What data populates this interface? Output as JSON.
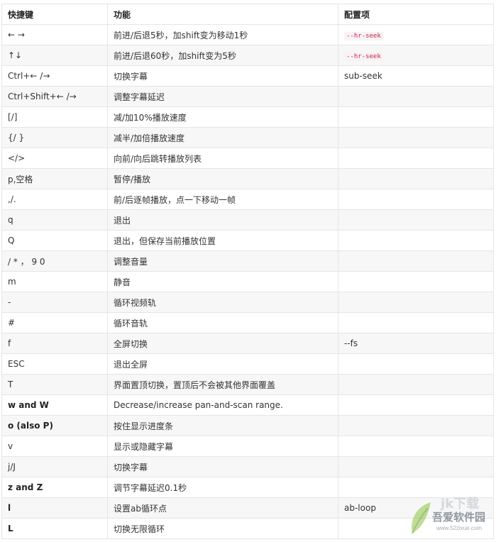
{
  "headers": [
    "快捷键",
    "功能",
    "配置项"
  ],
  "rows": [
    {
      "key": "← →",
      "func": "前进/后退5秒，加shift变为移动1秒",
      "opt": "--hr-seek",
      "opt_code": true
    },
    {
      "key": "↑↓",
      "func": "前进/后退60秒，加shift变为5秒",
      "opt": "--hr-seek",
      "opt_code": true
    },
    {
      "key": "Ctrl+← /→",
      "func": "切换字幕",
      "opt": "sub-seek"
    },
    {
      "key": "Ctrl+Shift+← /→",
      "func": "调整字幕延迟",
      "opt": ""
    },
    {
      "key": "[/]",
      "func": "减/加10%播放速度",
      "opt": ""
    },
    {
      "key": "{/ }",
      "func": "减半/加倍播放速度",
      "opt": ""
    },
    {
      "key": "</>",
      "func": "向前/向后跳转播放列表",
      "opt": ""
    },
    {
      "key": "p,空格",
      "func": "暂停/播放",
      "opt": ""
    },
    {
      "key": ",/.",
      "func": "前/后逐帧播放，点一下移动一帧",
      "opt": ""
    },
    {
      "key": "q",
      "func": "退出",
      "opt": ""
    },
    {
      "key": "Q",
      "func": "退出，但保存当前播放位置",
      "opt": ""
    },
    {
      "key": "/ * ，  9 0",
      "func": "调整音量",
      "opt": ""
    },
    {
      "key": "m",
      "func": "静音",
      "opt": ""
    },
    {
      "key": "-",
      "func": "循环视频轨",
      "opt": ""
    },
    {
      "key": "#",
      "func": "循环音轨",
      "opt": ""
    },
    {
      "key": "f",
      "func": "全屏切换",
      "opt": "--fs"
    },
    {
      "key": "ESC",
      "func": "退出全屏",
      "opt": ""
    },
    {
      "key": "T",
      "func": "界面置顶切换，置顶后不会被其他界面覆盖",
      "opt": ""
    },
    {
      "key": "w and W",
      "key_bold": true,
      "func": "Decrease/increase pan-and-scan range.",
      "opt": ""
    },
    {
      "key": "o (also P)",
      "key_bold": true,
      "func": "按住显示进度条",
      "opt": ""
    },
    {
      "key": "v",
      "func": "显示或隐藏字幕",
      "opt": ""
    },
    {
      "key": "j/J",
      "func": "切换字幕",
      "opt": ""
    },
    {
      "key": "z and Z",
      "key_bold": true,
      "func": "调节字幕延迟0.1秒",
      "opt": ""
    },
    {
      "key": "l",
      "key_bold": true,
      "func": "设置ab循环点",
      "opt": "ab-loop"
    },
    {
      "key": "L",
      "key_bold": true,
      "func": "切换无限循环",
      "opt": ""
    }
  ],
  "watermark": {
    "top": "jk下载",
    "brand": "吾爱软件园",
    "url": "www.52zixue.com"
  }
}
